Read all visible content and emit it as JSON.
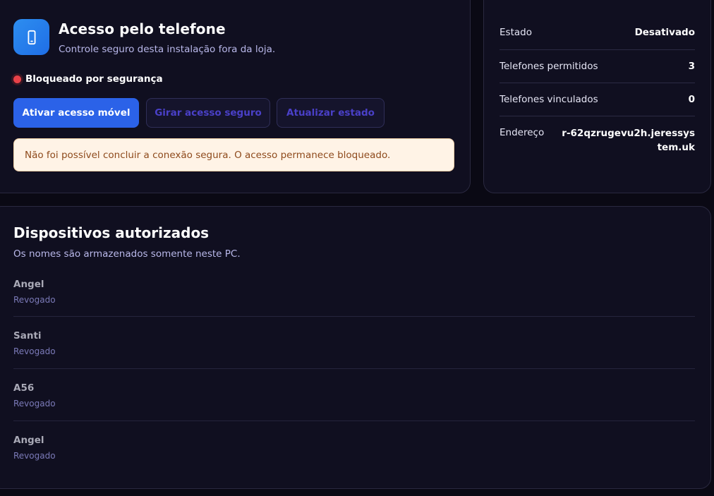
{
  "header": {
    "title": "Acesso pelo telefone",
    "subtitle": "Controle seguro desta instalação fora da loja.",
    "icon": "phone-icon"
  },
  "status": {
    "label": "Bloqueado por segurança",
    "color": "#e84148"
  },
  "actions": {
    "activate": "Ativar acesso móvel",
    "rotate": "Girar acesso seguro",
    "refresh": "Atualizar estado"
  },
  "alert": {
    "message": "Não foi possível concluir a conexão segura. O acesso permanece bloqueado."
  },
  "info": {
    "rows": [
      {
        "label": "Estado",
        "value": "Desativado"
      },
      {
        "label": "Telefones permitidos",
        "value": "3"
      },
      {
        "label": "Telefones vinculados",
        "value": "0"
      },
      {
        "label": "Endereço",
        "value": "r-62qzrugevu2h.jeressystem.uk"
      }
    ]
  },
  "devices": {
    "title": "Dispositivos autorizados",
    "subtitle": "Os nomes são armazenados somente neste PC.",
    "items": [
      {
        "name": "Angel",
        "state": "Revogado"
      },
      {
        "name": "Santi",
        "state": "Revogado"
      },
      {
        "name": "A56",
        "state": "Revogado"
      },
      {
        "name": "Angel",
        "state": "Revogado"
      }
    ]
  },
  "colors": {
    "accent": "#2b62e8",
    "background": "#0a0914",
    "card": "#100f20",
    "alert_bg": "#fff3e6",
    "alert_text": "#8e4a1c"
  }
}
